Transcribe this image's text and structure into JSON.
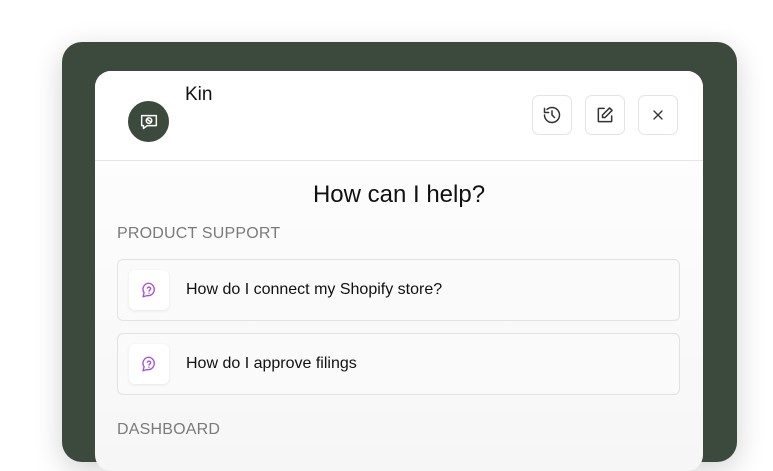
{
  "assistant": {
    "name": "Kin",
    "avatar_icon": "chat-bubble-icon",
    "accent_color": "#3b4a3c"
  },
  "header_actions": {
    "history_icon": "history-icon",
    "edit_icon": "edit-icon",
    "close_icon": "close-icon"
  },
  "main": {
    "title": "How can I help?",
    "sections": [
      {
        "label": "PRODUCT SUPPORT",
        "items": [
          {
            "label": "How do I connect my Shopify store?",
            "icon": "question-icon"
          },
          {
            "label": "How do I approve filings",
            "icon": "question-icon"
          }
        ]
      },
      {
        "label": "DASHBOARD",
        "items": []
      }
    ]
  },
  "colors": {
    "question_icon": "#a24fd6"
  }
}
